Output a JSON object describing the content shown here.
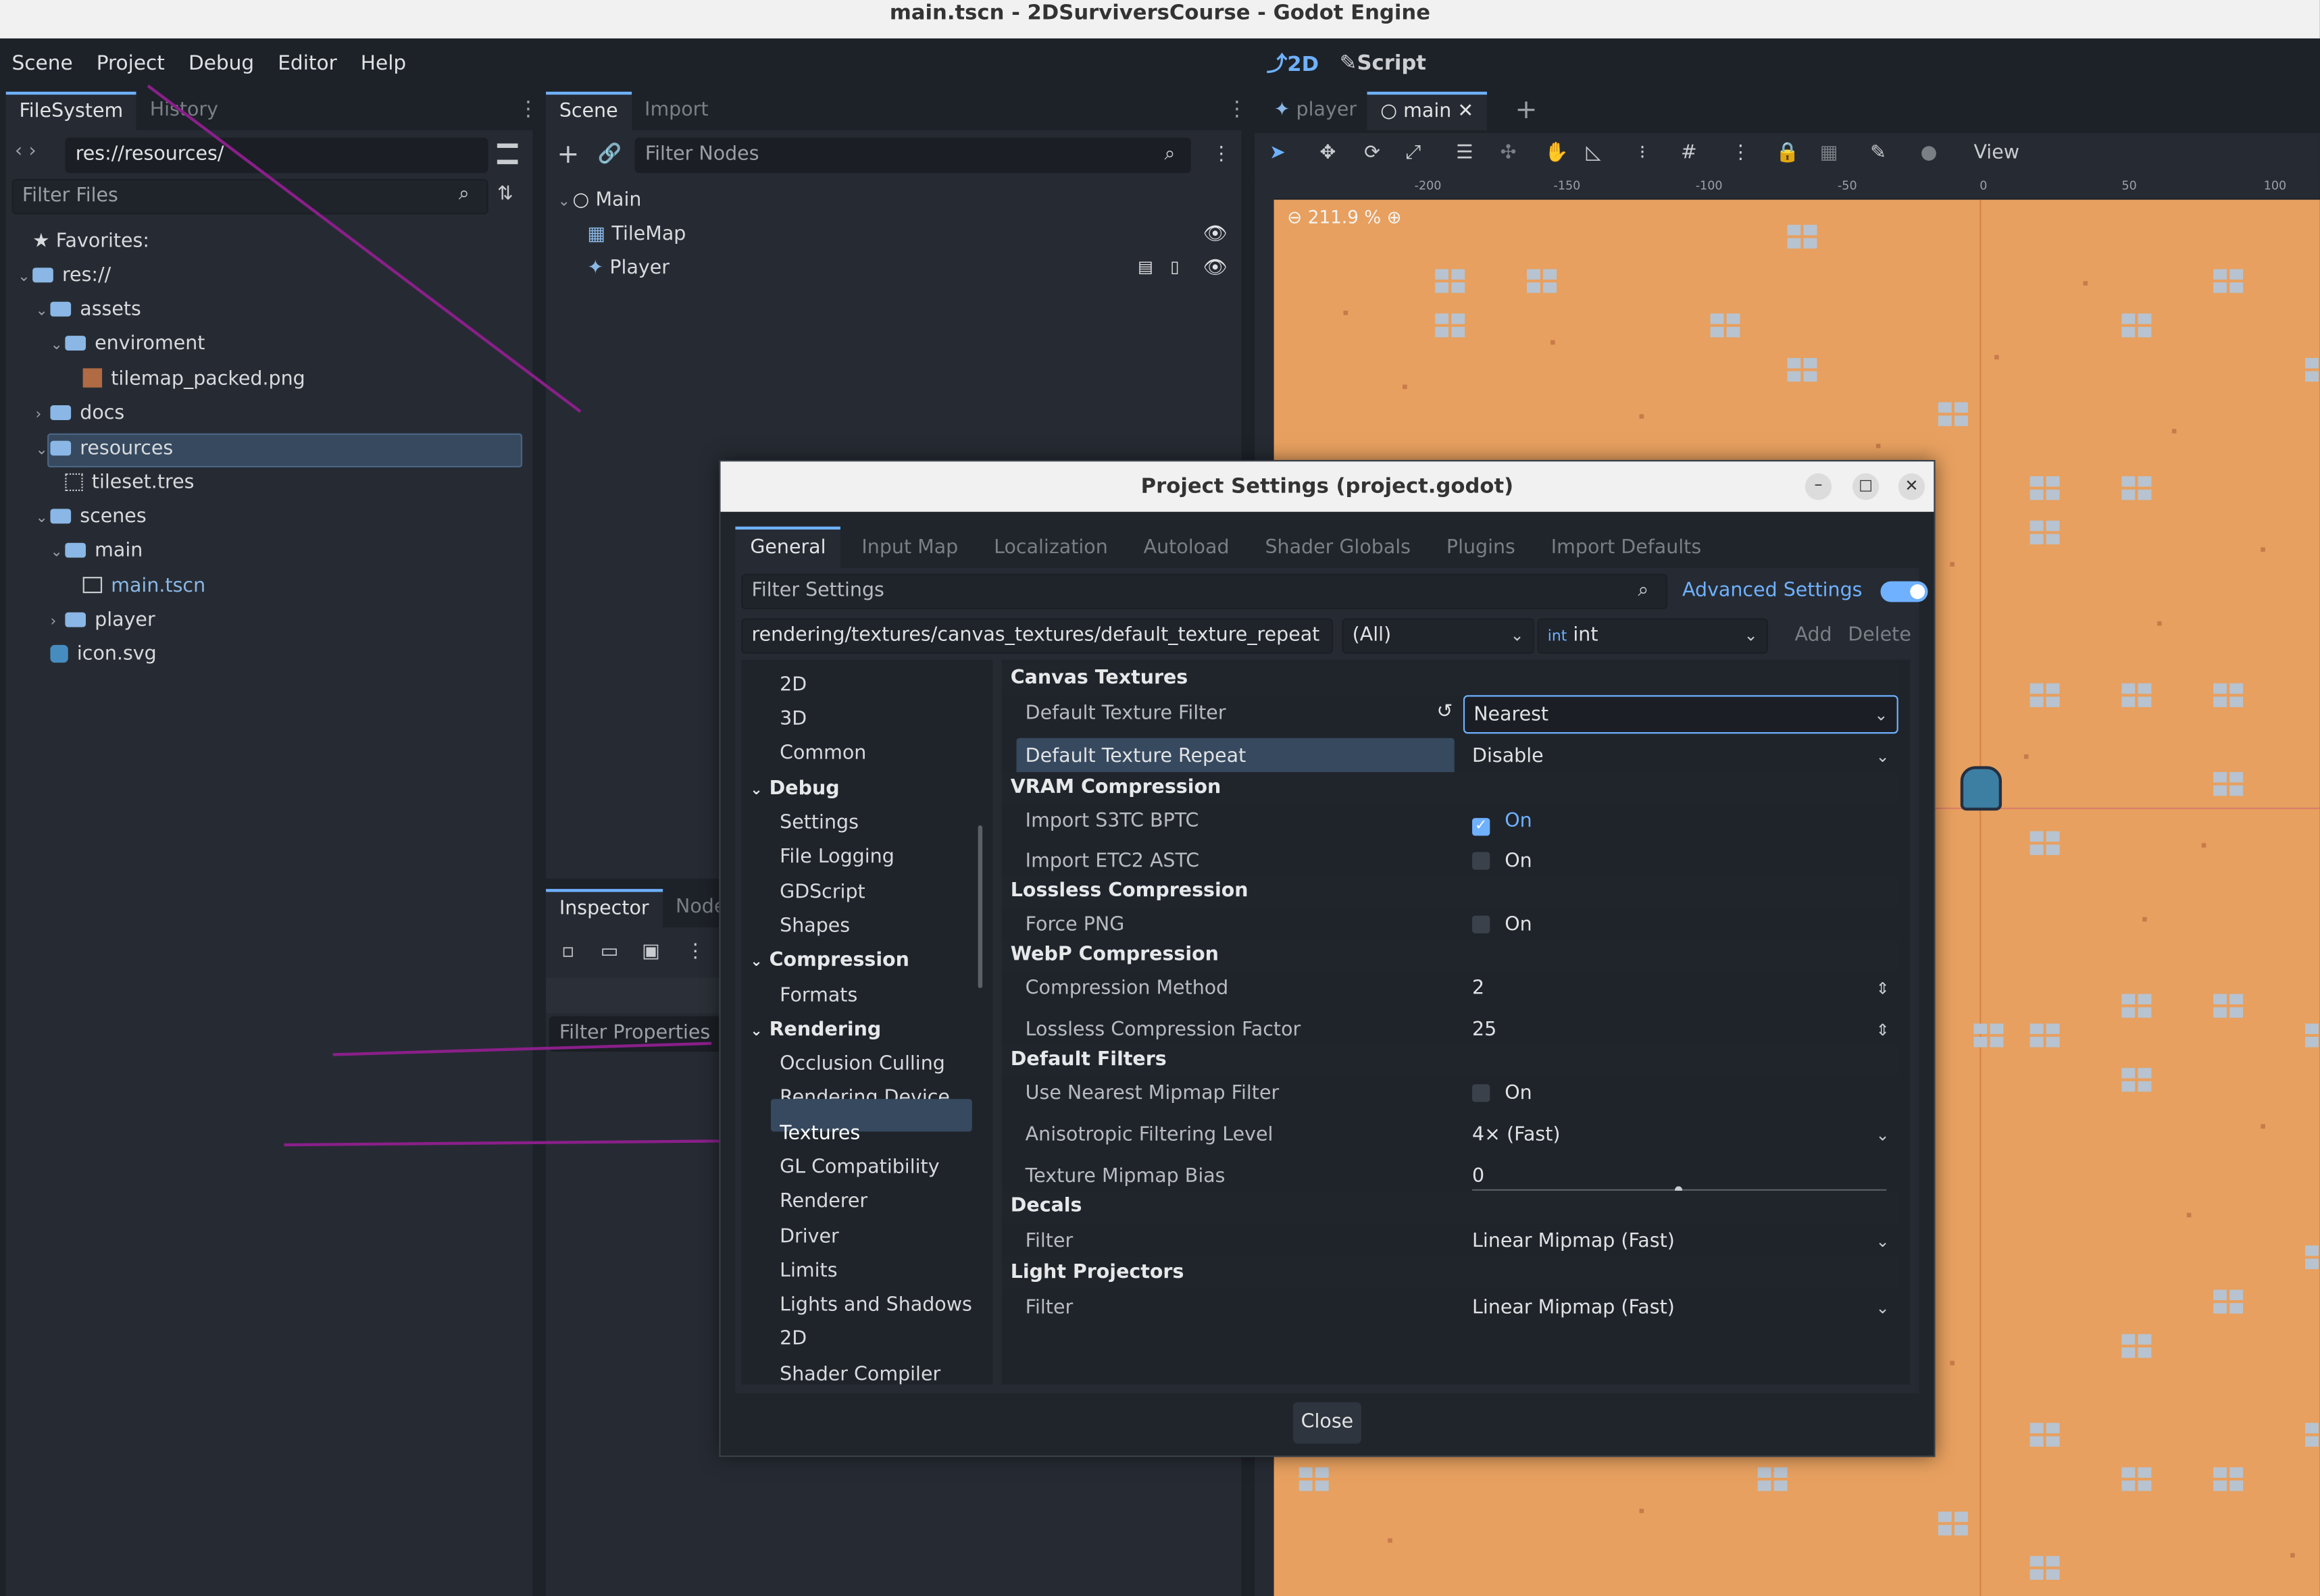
{
  "window_title": "main.tscn - 2DSurviversCourse - Godot Engine",
  "menu": [
    "Scene",
    "Project",
    "Debug",
    "Editor",
    "Help"
  ],
  "modes": {
    "mode_2d": "2D",
    "mode_script": "Script"
  },
  "filesystem": {
    "tabs": [
      "FileSystem",
      "History"
    ],
    "path": "res://resources/",
    "filter_placeholder": "Filter Files",
    "favorites": "Favorites:",
    "items": [
      "res://",
      "assets",
      "enviroment",
      "tilemap_packed.png",
      "docs",
      "resources",
      "tileset.tres",
      "scenes",
      "main",
      "main.tscn",
      "player",
      "icon.svg"
    ]
  },
  "scene": {
    "tabs": [
      "Scene",
      "Import"
    ],
    "filter_placeholder": "Filter Nodes",
    "nodes": [
      "Main",
      "TileMap",
      "Player"
    ]
  },
  "inspector": {
    "tabs": [
      "Inspector",
      "Node"
    ],
    "filter_placeholder": "Filter Properties"
  },
  "editor_tabs": [
    "player",
    "main"
  ],
  "viewport": {
    "toolbar_view": "View",
    "zoom": "211.9 %",
    "ruler_labels": [
      "-200",
      "-150",
      "-100",
      "-50",
      "0",
      "50",
      "100"
    ]
  },
  "dialog": {
    "title": "Project Settings (project.godot)",
    "tabs": [
      "General",
      "Input Map",
      "Localization",
      "Autoload",
      "Shader Globals",
      "Plugins",
      "Import Defaults"
    ],
    "filter_placeholder": "Filter Settings",
    "advanced_label": "Advanced Settings",
    "advanced_on": true,
    "property_path": "rendering/textures/canvas_textures/default_texture_repeat",
    "type_filter": "(All)",
    "type_value": "int",
    "add_label": "Add",
    "delete_label": "Delete",
    "left_tree": [
      "2D",
      "3D",
      "Common",
      "Debug",
      "Settings",
      "File Logging",
      "GDScript",
      "Shapes",
      "Compression",
      "Formats",
      "Rendering",
      "Occlusion Culling",
      "Rendering Device",
      "Textures",
      "GL Compatibility",
      "Renderer",
      "Driver",
      "Limits",
      "Lights and Shadows",
      "2D",
      "Shader Compiler"
    ],
    "sections": {
      "canvas_textures": "Canvas Textures",
      "vram": "VRAM Compression",
      "lossless": "Lossless Compression",
      "webp": "WebP Compression",
      "default_filters": "Default Filters",
      "decals": "Decals",
      "light_projectors": "Light Projectors"
    },
    "props": {
      "default_texture_filter": {
        "label": "Default Texture Filter",
        "value": "Nearest"
      },
      "default_texture_repeat": {
        "label": "Default Texture Repeat",
        "value": "Disable"
      },
      "import_s3tc": {
        "label": "Import S3TC BPTC",
        "value": "On",
        "checked": true
      },
      "import_etc2": {
        "label": "Import ETC2 ASTC",
        "value": "On",
        "checked": false
      },
      "force_png": {
        "label": "Force PNG",
        "value": "On",
        "checked": false
      },
      "compression_method": {
        "label": "Compression Method",
        "value": "2"
      },
      "lossless_factor": {
        "label": "Lossless Compression Factor",
        "value": "25"
      },
      "nearest_mipmap": {
        "label": "Use Nearest Mipmap Filter",
        "value": "On",
        "checked": false
      },
      "anisotropic": {
        "label": "Anisotropic Filtering Level",
        "value": "4× (Fast)"
      },
      "mipmap_bias": {
        "label": "Texture Mipmap Bias",
        "value": "0"
      },
      "decals_filter": {
        "label": "Filter",
        "value": "Linear Mipmap (Fast)"
      },
      "lp_filter": {
        "label": "Filter",
        "value": "Linear Mipmap (Fast)"
      }
    },
    "close_label": "Close"
  }
}
